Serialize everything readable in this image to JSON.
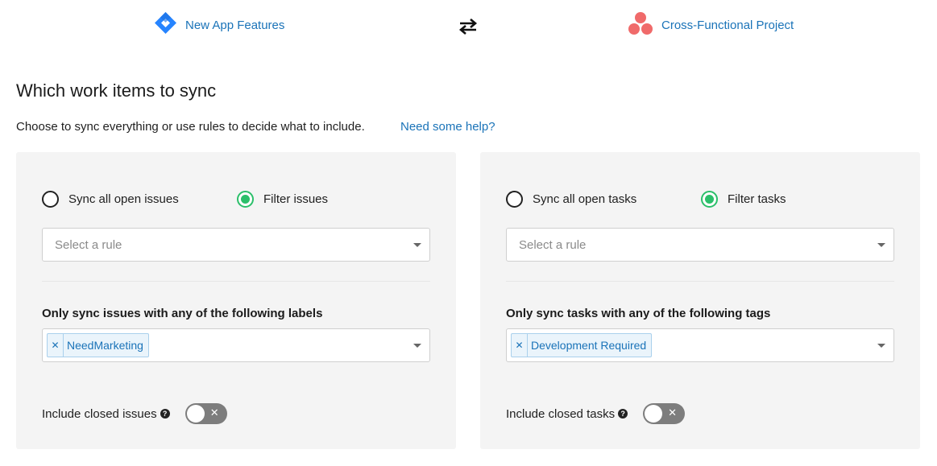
{
  "header": {
    "left_project": "New App Features",
    "right_project": "Cross-Functional Project",
    "swap_icon": "swap-arrows-icon",
    "left_icon": "jira-logo-icon",
    "right_icon": "asana-logo-icon"
  },
  "section": {
    "title": "Which work items to sync",
    "subtitle": "Choose to sync everything or use rules to decide what to include.",
    "help_link": "Need some help?"
  },
  "left_panel": {
    "radio_all": "Sync all open issues",
    "radio_filter": "Filter issues",
    "selected": "filter",
    "rule_placeholder": "Select a rule",
    "labels_heading": "Only sync issues with any of the following labels",
    "tags": [
      "NeedMarketing"
    ],
    "closed_label": "Include closed issues",
    "closed_enabled": false
  },
  "right_panel": {
    "radio_all": "Sync all open tasks",
    "radio_filter": "Filter tasks",
    "selected": "filter",
    "rule_placeholder": "Select a rule",
    "labels_heading": "Only sync tasks with any of the following tags",
    "tags": [
      "Development Required"
    ],
    "closed_label": "Include closed tasks",
    "closed_enabled": false
  },
  "colors": {
    "accent_link": "#1a73b8",
    "radio_on": "#2bbf6a",
    "panel_bg": "#f4f4f4",
    "toggle_off": "#7d7d7d"
  }
}
